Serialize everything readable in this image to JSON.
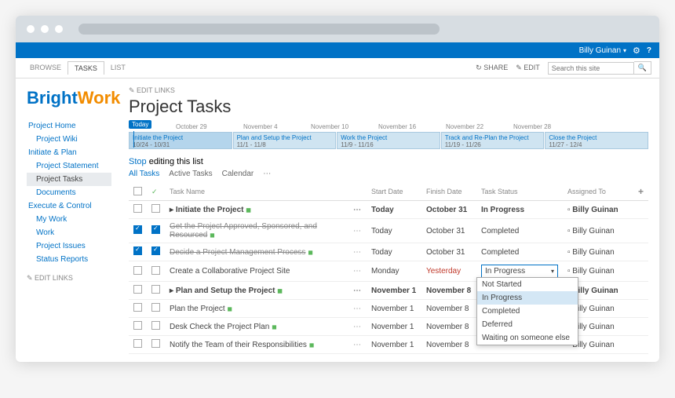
{
  "ribbon": {
    "user": "Billy Guinan",
    "share": "SHARE",
    "edit": "EDIT"
  },
  "tabs": {
    "browse": "BROWSE",
    "tasks": "TASKS",
    "list": "LIST"
  },
  "search": {
    "placeholder": "Search this site"
  },
  "logo": {
    "a": "Bright",
    "b": "Work"
  },
  "nav": [
    {
      "label": "Project Home",
      "sub": false
    },
    {
      "label": "Project Wiki",
      "sub": true
    },
    {
      "label": "Initiate & Plan",
      "sub": false
    },
    {
      "label": "Project Statement",
      "sub": true
    },
    {
      "label": "Project Tasks",
      "sub": true,
      "sel": true
    },
    {
      "label": "Documents",
      "sub": true
    },
    {
      "label": "Execute & Control",
      "sub": false
    },
    {
      "label": "My Work",
      "sub": true
    },
    {
      "label": "Work",
      "sub": true
    },
    {
      "label": "Project Issues",
      "sub": true
    },
    {
      "label": "Status Reports",
      "sub": true
    }
  ],
  "edit_links": "EDIT LINKS",
  "page_title": "Project Tasks",
  "today": "Today",
  "tl_dates": [
    "October 29",
    "November 4",
    "November 10",
    "November 16",
    "November 22",
    "November 28"
  ],
  "tl_bars": [
    {
      "t": "Initiate the Project",
      "d": "10/24 - 10/31",
      "sel": true
    },
    {
      "t": "Plan and Setup the Project",
      "d": "11/1 - 11/8"
    },
    {
      "t": "Work the Project",
      "d": "11/9 - 11/16"
    },
    {
      "t": "Track and Re-Plan the Project",
      "d": "11/19 - 11/26"
    },
    {
      "t": "Close the Project",
      "d": "11/27 - 12/4"
    }
  ],
  "stop": {
    "a": "Stop",
    "b": " editing this list"
  },
  "viewtabs": {
    "all": "All Tasks",
    "active": "Active Tasks",
    "cal": "Calendar",
    "more": "⋯"
  },
  "headers": {
    "name": "Task Name",
    "start": "Start Date",
    "finish": "Finish Date",
    "status": "Task Status",
    "assigned": "Assigned To"
  },
  "rows": [
    {
      "chk": false,
      "bold": true,
      "exp": "▸",
      "name": "Initiate the Project",
      "g": "◼",
      "start": "Today",
      "finish": "October 31",
      "status": "In Progress",
      "assigned": "Billy Guinan",
      "done": false
    },
    {
      "chk": true,
      "bold": false,
      "name": "Get the Project Approved, Sponsored, and Resourced",
      "g": "◼",
      "start": "Today",
      "finish": "October 31",
      "status": "Completed",
      "assigned": "Billy Guinan",
      "done": true
    },
    {
      "chk": true,
      "bold": false,
      "name": "Decide a Project Management Process",
      "g": "◼",
      "start": "Today",
      "finish": "October 31",
      "status": "Completed",
      "assigned": "Billy Guinan",
      "done": true
    },
    {
      "chk": false,
      "bold": false,
      "name": "Create a Collaborative Project Site",
      "g": "",
      "start": "Monday",
      "finish": "Yesterday",
      "status": "In Progress",
      "assigned": "Billy Guinan",
      "done": false,
      "editing": true,
      "red": true
    },
    {
      "chk": false,
      "bold": true,
      "exp": "▸",
      "name": "Plan and Setup the Project",
      "g": "◼",
      "start": "November 1",
      "finish": "November 8",
      "status": "",
      "assigned": "Billy Guinan",
      "done": false
    },
    {
      "chk": false,
      "bold": false,
      "name": "Plan the Project",
      "g": "◼",
      "start": "November 1",
      "finish": "November 8",
      "status": "",
      "assigned": "Billy Guinan",
      "done": false
    },
    {
      "chk": false,
      "bold": false,
      "name": "Desk Check the Project Plan",
      "g": "◼",
      "start": "November 1",
      "finish": "November 8",
      "status": "",
      "assigned": "Billy Guinan",
      "done": false
    },
    {
      "chk": false,
      "bold": false,
      "name": "Notify the Team of their Responsibilities",
      "g": "◼",
      "start": "November 1",
      "finish": "November 8",
      "status": "",
      "assigned": "Billy Guinan",
      "done": false
    }
  ],
  "dropdown": [
    "Not Started",
    "In Progress",
    "Completed",
    "Deferred",
    "Waiting on someone else"
  ],
  "dropdown_hl": "In Progress"
}
